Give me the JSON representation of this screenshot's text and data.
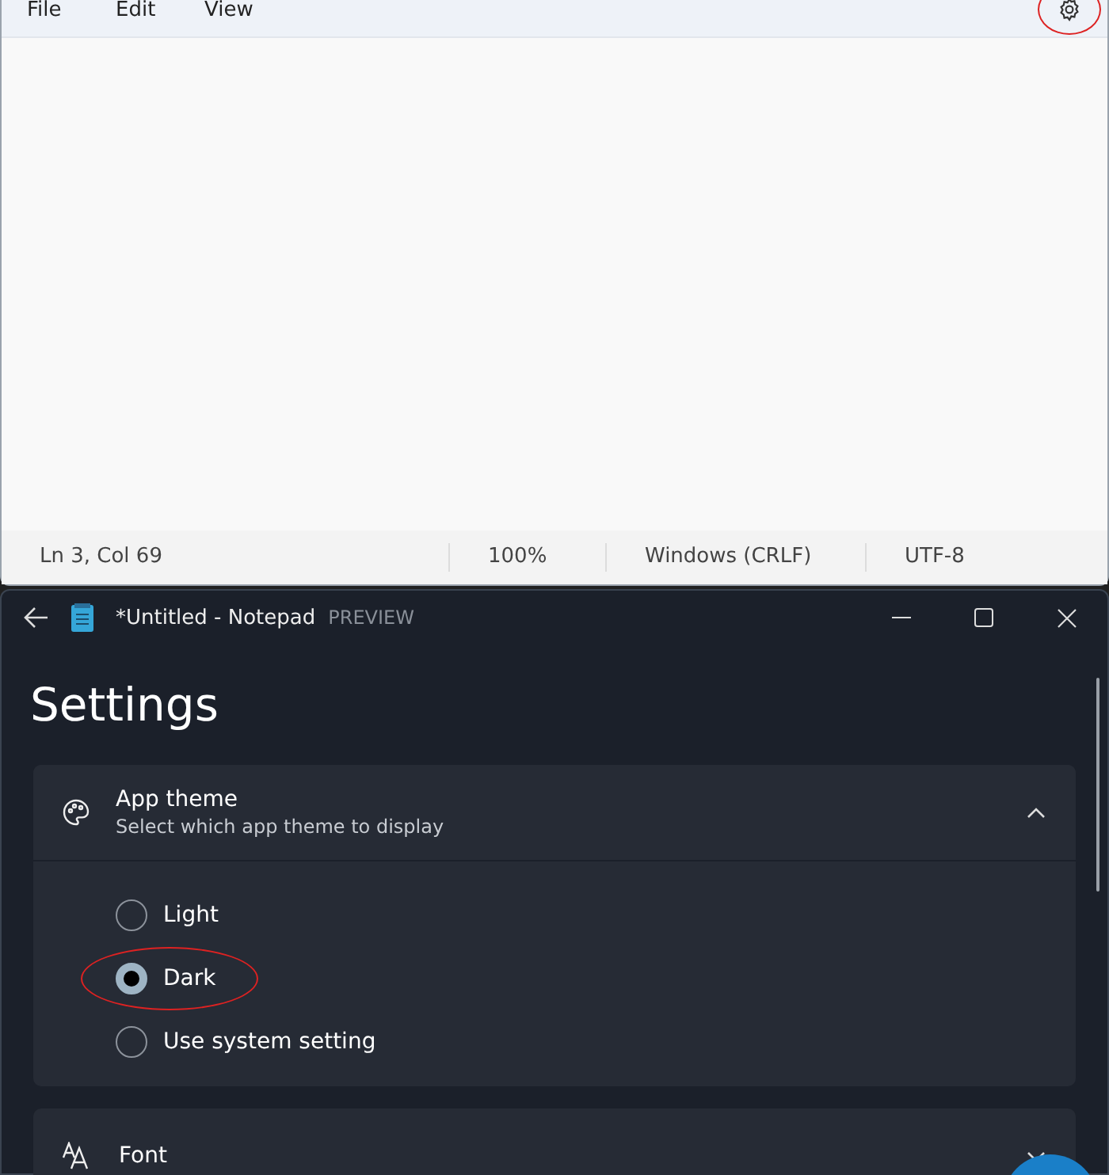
{
  "editor": {
    "menu": [
      {
        "label": "File"
      },
      {
        "label": "Edit"
      },
      {
        "label": "View"
      }
    ],
    "settings_button": {
      "highlighted": true
    },
    "status_bar": [
      "Ln 3, Col 69",
      "100%",
      "Windows (CRLF)",
      "UTF-8"
    ]
  },
  "settings_window": {
    "title": "*Untitled - Notepad",
    "badge": "PREVIEW",
    "heading": "Settings",
    "sections": [
      {
        "kind": "theme",
        "title": "App theme",
        "subtitle": "Select which app theme to display",
        "expanded": true,
        "options": [
          {
            "label": "Light",
            "selected": false,
            "highlighted": false
          },
          {
            "label": "Dark",
            "selected": true,
            "highlighted": true
          },
          {
            "label": "Use system setting",
            "selected": false,
            "highlighted": false
          }
        ]
      },
      {
        "kind": "font",
        "title": "Font",
        "expanded": false
      }
    ]
  }
}
